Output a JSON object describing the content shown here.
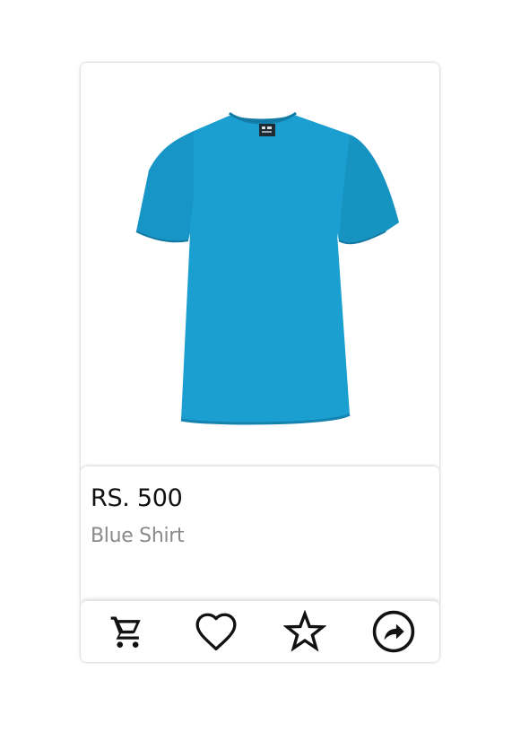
{
  "product": {
    "price": "RS. 500",
    "name": "Blue Shirt",
    "image": {
      "subject": "tshirt-image",
      "color": "#1b9fd1"
    }
  },
  "actions": [
    {
      "icon": "cart-icon"
    },
    {
      "icon": "heart-icon"
    },
    {
      "icon": "star-icon"
    },
    {
      "icon": "share-icon"
    }
  ],
  "colors": {
    "price": "#111111",
    "name": "#8a8a8a",
    "icon": "#111111"
  }
}
